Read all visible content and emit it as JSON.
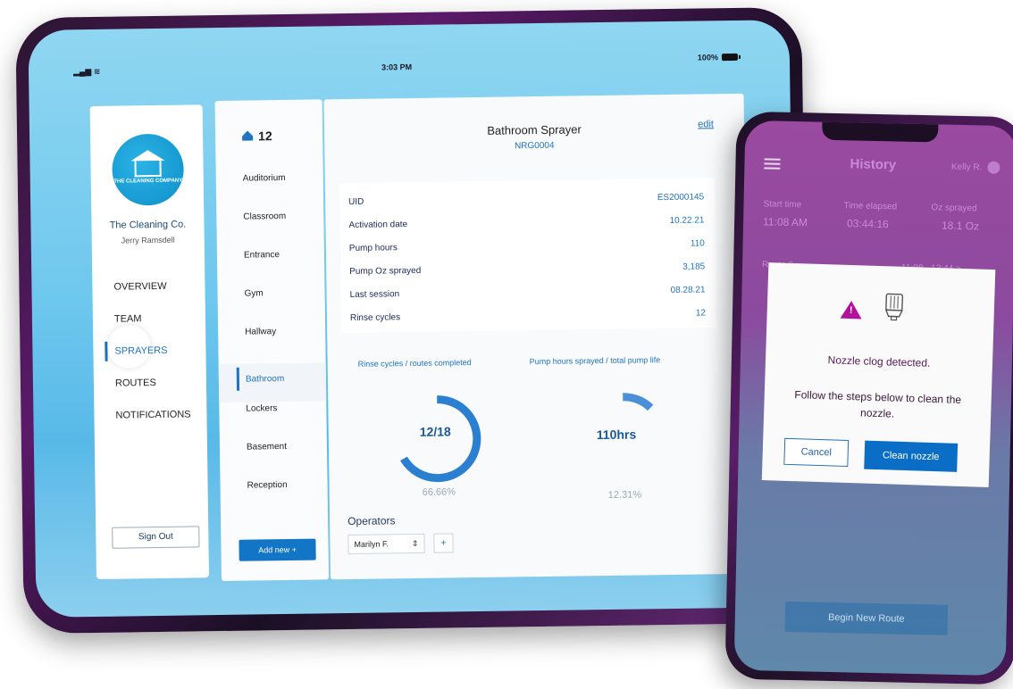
{
  "tablet": {
    "status": {
      "time": "3:03 PM",
      "battery": "100%"
    },
    "sidebar": {
      "logo_text": "THE CLEANING COMPANY",
      "org_name": "The Cleaning Co.",
      "user_name": "Jerry Ramsdell",
      "nav": [
        {
          "label": "OVERVIEW"
        },
        {
          "label": "TEAM"
        },
        {
          "label": "SPRAYERS"
        },
        {
          "label": "ROUTES"
        },
        {
          "label": "NOTIFICATIONS"
        }
      ],
      "active_nav": "SPRAYERS",
      "sign_out": "Sign Out"
    },
    "locations": {
      "count": "12",
      "items": [
        {
          "label": "Auditorium"
        },
        {
          "label": "Classroom"
        },
        {
          "label": "Entrance"
        },
        {
          "label": "Gym"
        },
        {
          "label": "Hallway"
        },
        {
          "label": "Bathroom"
        },
        {
          "label": "Lockers"
        },
        {
          "label": "Basement"
        },
        {
          "label": "Reception"
        }
      ],
      "active": "Bathroom",
      "add_new": "Add new  +"
    },
    "detail": {
      "title": "Bathroom Sprayer",
      "subtitle": "NRG0004",
      "edit": "edit",
      "info": [
        {
          "k": "UID",
          "v": "ES2000145"
        },
        {
          "k": "Activation date",
          "v": "10.22.21"
        },
        {
          "k": "Pump hours",
          "v": "110"
        },
        {
          "k": "Pump Oz sprayed",
          "v": "3,185"
        },
        {
          "k": "Last session",
          "v": "08.28.21"
        },
        {
          "k": "Rinse cycles",
          "v": "12"
        }
      ],
      "chart1": {
        "label": "Rinse cycles / routes completed",
        "center": "12/18",
        "percent": "66.66%",
        "fraction": 0.6666
      },
      "chart2": {
        "label": "Pump hours sprayed / total pump life",
        "center": "110hrs",
        "percent": "12.31%",
        "fraction": 0.1231
      },
      "operators_title": "Operators",
      "operator_selected": "Marilyn F.",
      "add_operator": "+"
    }
  },
  "phone": {
    "title": "History",
    "user": "Kelly R.",
    "columns": [
      {
        "header": "Start time",
        "value": "11:08 AM"
      },
      {
        "header": "Time elapsed",
        "value": "03:44:16"
      },
      {
        "header": "Oz sprayed",
        "value": "18.1 Oz"
      }
    ],
    "route": {
      "label": "Route 2",
      "time": "11:08 - 13:44 >"
    },
    "modal": {
      "message": "Nozzle clog detected.",
      "steps": "Follow the steps below to clean the nozzle.",
      "cancel": "Cancel",
      "confirm": "Clean nozzle"
    },
    "begin_route": "Begin New Route"
  },
  "colors": {
    "accent": "#1e73c2",
    "warning": "#b4129e",
    "phone_tint": "#9a4aa0"
  }
}
